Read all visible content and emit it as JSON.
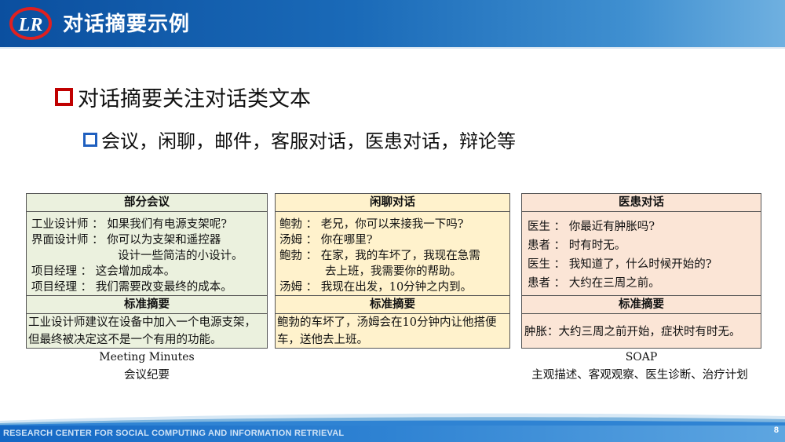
{
  "header": {
    "logo_text": "LR",
    "title": "对话摘要示例"
  },
  "bullets": {
    "level1": "对话摘要关注对话类文本",
    "level2": "会议，闲聊，邮件，客服对话，医患对话，辩论等"
  },
  "panels": [
    {
      "header": "部分会议",
      "lines": [
        "工业设计师 ： 如果我们有电源支架呢?",
        "界面设计师 ： 你可以为支架和遥控器",
        "设计一些简洁的小设计。",
        "项目经理   ： 这会增加成本。",
        "项目经理   ： 我们需要改变最终的成本。"
      ],
      "summary_header": "标准摘要",
      "summary": "工业设计师建议在设备中加入一个电源支架，但最终被决定这不是一个有用的功能。",
      "caption_en": "Meeting Minutes",
      "caption_zh": "会议纪要"
    },
    {
      "header": "闲聊对话",
      "lines": [
        "鲍勃 ： 老兄，你可以来接我一下吗?",
        "汤姆 ： 你在哪里?",
        "鲍勃 ： 在家，我的车坏了，我现在急需",
        "去上班，我需要你的帮助。",
        "汤姆 ： 我现在出发，10分钟之内到。"
      ],
      "summary_header": "标准摘要",
      "summary": "鲍勃的车坏了，汤姆会在10分钟内让他搭便车，送他去上班。"
    },
    {
      "header": "医患对话",
      "lines": [
        "医生 ： 你最近有肿胀吗?",
        "患者 ： 时有时无。",
        "医生 ： 我知道了，什么时候开始的?",
        "患者 ： 大约在三周之前。"
      ],
      "summary_header": "标准摘要",
      "summary": "肿胀：大约三周之前开始，症状时有时无。",
      "caption_en": "SOAP",
      "caption_zh": "主观描述、客观观察、医生诊断、治疗计划"
    }
  ],
  "footer": {
    "org": "RESEARCH CENTER FOR SOCIAL COMPUTING AND INFORMATION RETRIEVAL",
    "page": "8"
  },
  "colors": {
    "header_blue": "#0b4f9f",
    "bullet_red": "#c00000",
    "bullet_blue": "#1f5fbf",
    "meeting_bg": "#ebf1de",
    "chat_bg": "#fff2cc",
    "medical_bg": "#fbe5d6"
  }
}
